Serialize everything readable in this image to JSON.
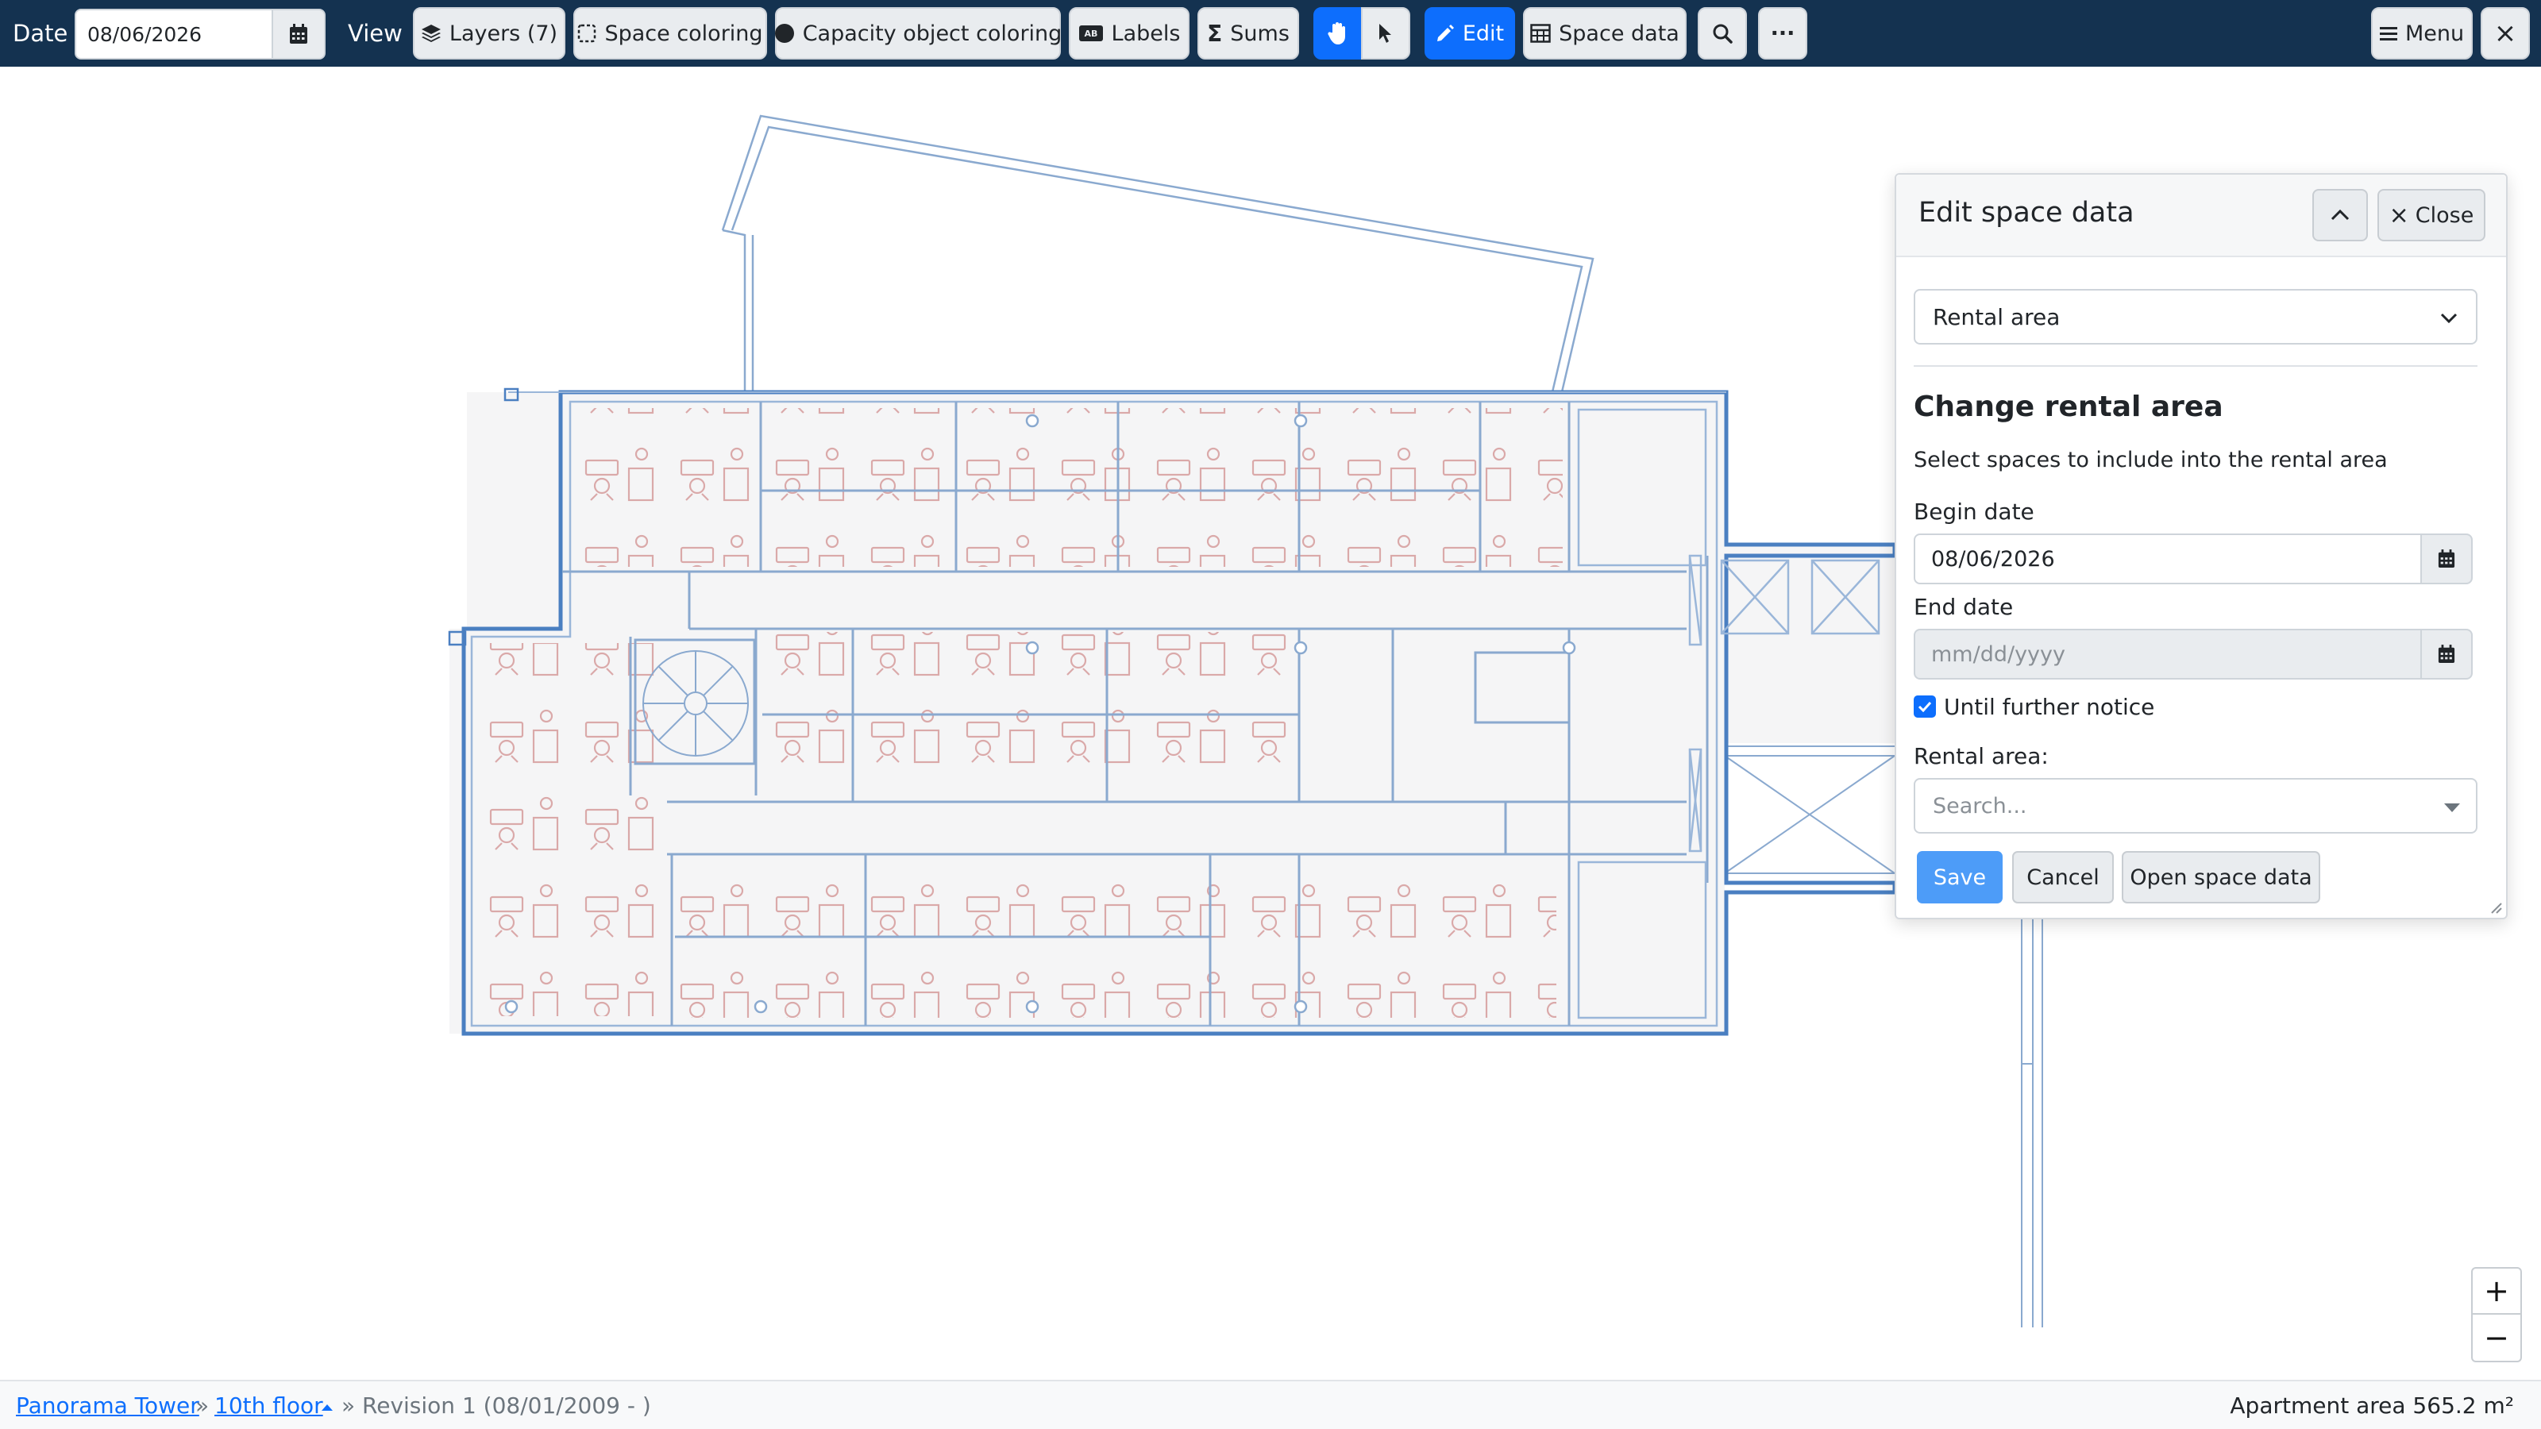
{
  "toolbar": {
    "date_label": "Date",
    "date_value": "08/06/2026",
    "view_label": "View",
    "layers": "Layers (7)",
    "space_coloring": "Space coloring",
    "capacity_coloring": "Capacity object coloring",
    "labels": "Labels",
    "sums": "Sums",
    "edit": "Edit",
    "space_data": "Space data",
    "more": "···",
    "menu": "Menu",
    "close": "×"
  },
  "panel": {
    "title": "Edit space data",
    "close_label": "Close",
    "select_value": "Rental area",
    "heading": "Change rental area",
    "description": "Select spaces to include into the rental area",
    "begin_label": "Begin date",
    "begin_value": "08/06/2026",
    "end_label": "End date",
    "end_placeholder": "mm/dd/yyyy",
    "until_notice": "Until further notice",
    "rental_label": "Rental area:",
    "search_placeholder": "Search...",
    "save": "Save",
    "cancel": "Cancel",
    "open_space_data": "Open space data"
  },
  "zoom": {
    "in": "+",
    "out": "−"
  },
  "footer": {
    "building": "Panorama Tower",
    "sep1": "»",
    "floor": "10th floor",
    "revision": "» Revision 1 (08/01/2009 - )",
    "area": "Apartment area 565.2 m²"
  },
  "icons": {
    "calendar": "calendar-icon",
    "layers": "layers-icon",
    "space_coloring": "dashed-square-icon",
    "capacity": "filled-circle-icon",
    "labels": "label-tag-icon",
    "sums": "sigma-icon",
    "hand": "hand-icon",
    "pointer": "pointer-icon",
    "edit": "pencil-icon",
    "table": "table-icon",
    "search": "search-icon",
    "menu": "hamburger-icon",
    "chevron_up": "chevron-up-icon",
    "chevron_down": "chevron-down-icon",
    "check": "checkmark-icon"
  },
  "colors": {
    "toolbar_bg": "#143250",
    "primary": "#0d6efd",
    "save_button": "#4d9cf8",
    "wall": "#4a7fc1",
    "furniture": "#d7a0a0"
  }
}
